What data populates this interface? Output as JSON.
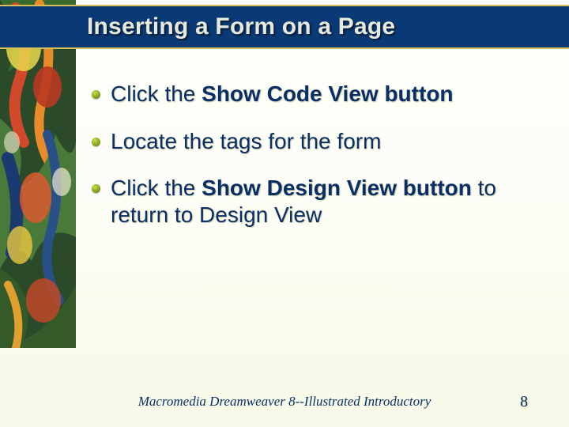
{
  "title": "Inserting a Form on a Page",
  "bullets": [
    {
      "pre": "Click the ",
      "bold": "Show Code View button",
      "post": ""
    },
    {
      "pre": "Locate the tags for the form",
      "bold": "",
      "post": ""
    },
    {
      "pre": "Click the ",
      "bold": "Show Design View button",
      "post": " to return to Design View"
    }
  ],
  "footer": "Macromedia Dreamweaver 8--Illustrated Introductory",
  "page_number": "8"
}
